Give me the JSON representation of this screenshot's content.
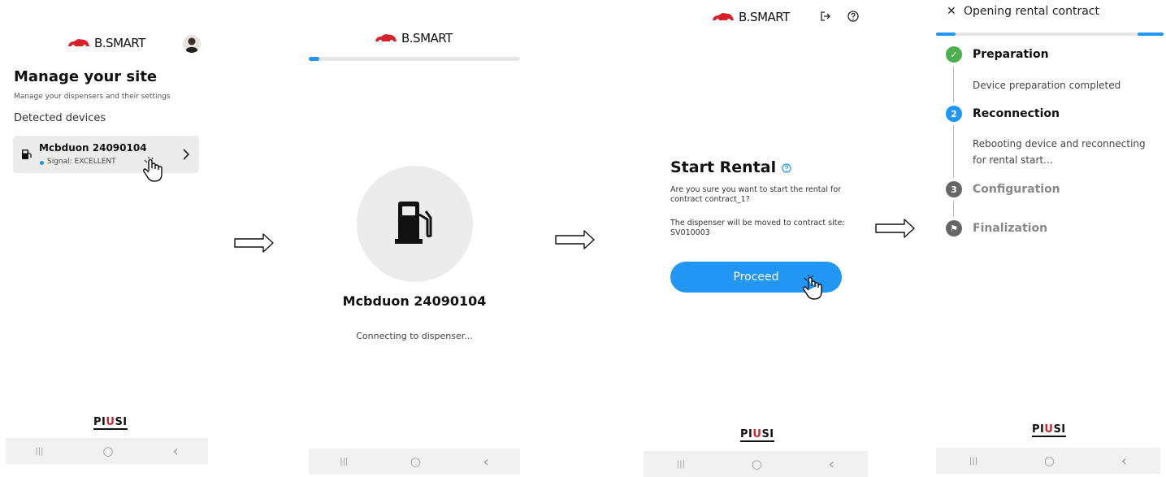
{
  "brand": {
    "logo_text": "B.SMART",
    "footer_logo": {
      "a": "PI",
      "b": "U",
      "c": "SI"
    }
  },
  "screen1": {
    "title": "Manage your site",
    "subtitle": "Manage your dispensers and their settings",
    "section": "Detected devices",
    "device": {
      "name": "Mcbduon 24090104",
      "signal": "Signal: EXCELLENT"
    }
  },
  "screen2": {
    "progress": 0.05,
    "device_name": "Mcbduon 24090104",
    "status": "Connecting to dispenser..."
  },
  "screen3": {
    "title": "Start Rental",
    "question": "Are you sure you want to start the rental for contract contract_1?",
    "info": "The dispenser will be moved to contract site: SV010003",
    "proceed_label": "Proceed"
  },
  "screen4": {
    "header": "Opening rental contract",
    "close_glyph": "✕",
    "steps": [
      {
        "num": "✓",
        "title": "Preparation",
        "desc": "Device preparation completed",
        "state": "done"
      },
      {
        "num": "2",
        "title": "Reconnection",
        "desc": "Rebooting device and reconnecting for rental start...",
        "state": "active"
      },
      {
        "num": "3",
        "title": "Configuration",
        "desc": "",
        "state": "pending"
      },
      {
        "num": "⚑",
        "title": "Finalization",
        "desc": "",
        "state": "pending"
      }
    ]
  },
  "nav": {
    "recents": "|||",
    "home": "○",
    "back": "‹"
  },
  "colors": {
    "accent": "#2196f3",
    "done": "#4caf50",
    "brand_red": "#d8212b",
    "pending": "#888888"
  }
}
